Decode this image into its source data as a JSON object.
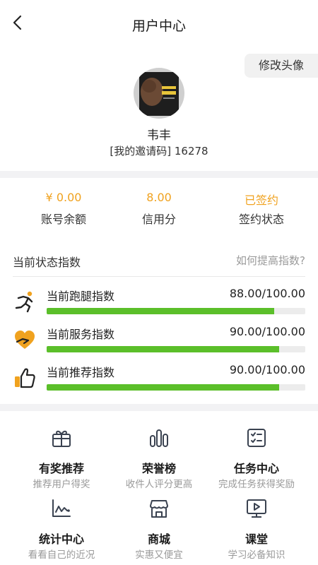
{
  "header": {
    "title": "用户中心"
  },
  "profile": {
    "edit_avatar_label": "修改头像",
    "name": "韦丰",
    "invite_text": "[我的邀请码] 16278"
  },
  "stats": [
    {
      "value": "¥  0.00",
      "label": "账号余额"
    },
    {
      "value": "8.00",
      "label": "信用分"
    },
    {
      "value": "已签约",
      "label": "签约状态"
    }
  ],
  "status_section": {
    "title": "当前状态指数",
    "link": "如何提高指数?",
    "metrics": [
      {
        "name": "当前跑腿指数",
        "score": "88.00/100.00",
        "fraction": 0.88,
        "icon": "runner-icon"
      },
      {
        "name": "当前服务指数",
        "score": "90.00/100.00",
        "fraction": 0.9,
        "icon": "heart-hand-icon"
      },
      {
        "name": "当前推荐指数",
        "score": "90.00/100.00",
        "fraction": 0.9,
        "icon": "thumbs-up-icon"
      }
    ]
  },
  "menu": [
    {
      "title": "有奖推荐",
      "subtitle": "推荐用户得奖",
      "icon": "gift-icon"
    },
    {
      "title": "荣誉榜",
      "subtitle": "收件人评分更高",
      "icon": "bar-chart-icon"
    },
    {
      "title": "任务中心",
      "subtitle": "完成任务获得奖励",
      "icon": "checklist-icon"
    },
    {
      "title": "统计中心",
      "subtitle": "看看自己的近况",
      "icon": "line-chart-icon"
    },
    {
      "title": "商城",
      "subtitle": "实惠又便宜",
      "icon": "store-icon"
    },
    {
      "title": "课堂",
      "subtitle": "学习必备知识",
      "icon": "video-class-icon"
    }
  ],
  "colors": {
    "accent": "#f0a21f",
    "progress": "#5bbf2a",
    "icon_stroke": "#3a4250"
  }
}
